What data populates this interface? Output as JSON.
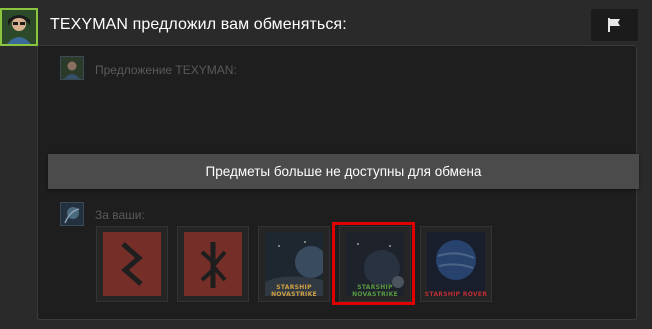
{
  "header": {
    "title": "TEXYMAN предложил вам обменяться:"
  },
  "offer": {
    "their_label": "Предложение TEXYMAN:",
    "banner": "Предметы больше не доступны для обмена",
    "your_label": "За ваши:"
  },
  "items": [
    {
      "name": "Sowilo rune card",
      "icon": "sowilo-rune",
      "colors": [
        "#b8362c",
        "#1a1a1a"
      ]
    },
    {
      "name": "Kaunan rune card",
      "icon": "rune-k",
      "colors": [
        "#b8362c",
        "#1a1a1a"
      ]
    },
    {
      "name": "Starship card 1",
      "icon": "planet-scene",
      "caption": "STARSHIP NOVASTRIKE",
      "colors": [
        "#1a2a3a",
        "#d0a040"
      ]
    },
    {
      "name": "Starship card 2",
      "icon": "planet-scene",
      "caption": "STARSHIP NOVASTRIKE",
      "highlighted": true,
      "colors": [
        "#1a2030",
        "#5a9a40"
      ]
    },
    {
      "name": "Blue planet card",
      "icon": "blue-planet",
      "caption": "STARSHIP ROVER",
      "colors": [
        "#2a5aa8",
        "#c03030"
      ]
    }
  ],
  "colors": {
    "highlight": "#e00000",
    "avatar_border": "#8bc53f"
  }
}
